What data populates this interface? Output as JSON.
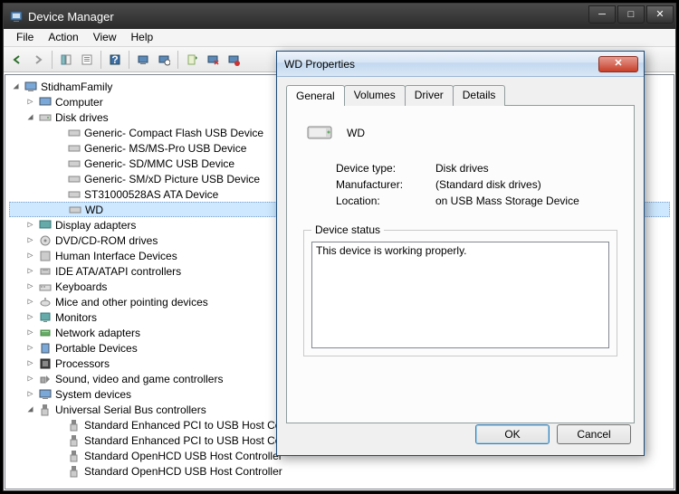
{
  "window": {
    "title": "Device Manager",
    "menu": [
      "File",
      "Action",
      "View",
      "Help"
    ]
  },
  "tree": {
    "root": "StidhamFamily",
    "computer": "Computer",
    "diskdrives": "Disk drives",
    "disks": [
      "Generic- Compact Flash USB Device",
      "Generic- MS/MS-Pro USB Device",
      "Generic- SD/MMC USB Device",
      "Generic- SM/xD Picture USB Device",
      "ST31000528AS ATA Device",
      "WD"
    ],
    "cats": [
      "Display adapters",
      "DVD/CD-ROM drives",
      "Human Interface Devices",
      "IDE ATA/ATAPI controllers",
      "Keyboards",
      "Mice and other pointing devices",
      "Monitors",
      "Network adapters",
      "Portable Devices",
      "Processors",
      "Sound, video and game controllers",
      "System devices",
      "Universal Serial Bus controllers"
    ],
    "usb": [
      "Standard Enhanced PCI to USB Host Controller",
      "Standard Enhanced PCI to USB Host Controller",
      "Standard OpenHCD USB Host Controller",
      "Standard OpenHCD USB Host Controller"
    ]
  },
  "dlg": {
    "title": "WD  Properties",
    "tabs": [
      "General",
      "Volumes",
      "Driver",
      "Details"
    ],
    "dev_name": "WD",
    "type_k": "Device type:",
    "type_v": "Disk drives",
    "mfr_k": "Manufacturer:",
    "mfr_v": "(Standard disk drives)",
    "loc_k": "Location:",
    "loc_v": "on USB Mass Storage Device",
    "status_legend": "Device status",
    "status_text": "This device is working properly.",
    "ok": "OK",
    "cancel": "Cancel"
  }
}
